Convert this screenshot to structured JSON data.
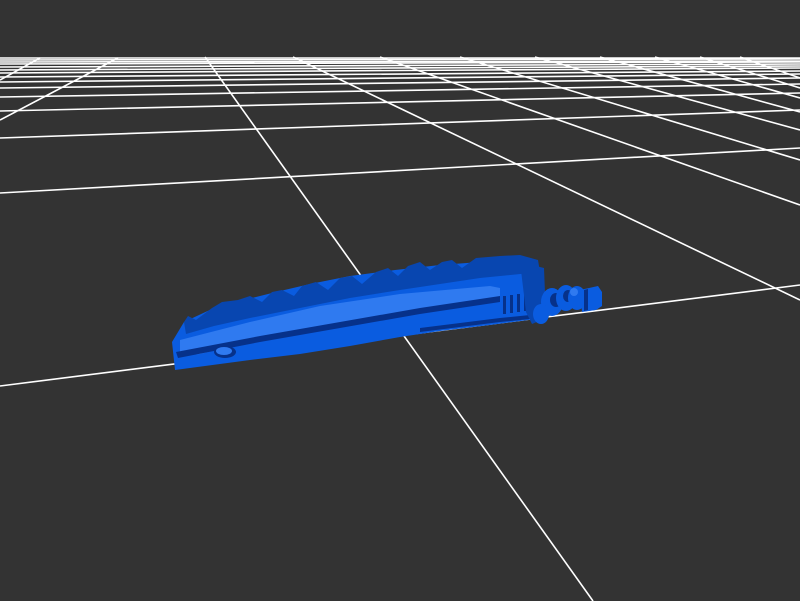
{
  "viewport": {
    "background_color": "#333333",
    "grid_color": "#ffffff",
    "grid_visible": true
  },
  "model": {
    "color": "#0a5ce0",
    "shade_color": "#0846b0",
    "highlight_color": "#2f7af0",
    "dark_color": "#06318a"
  }
}
